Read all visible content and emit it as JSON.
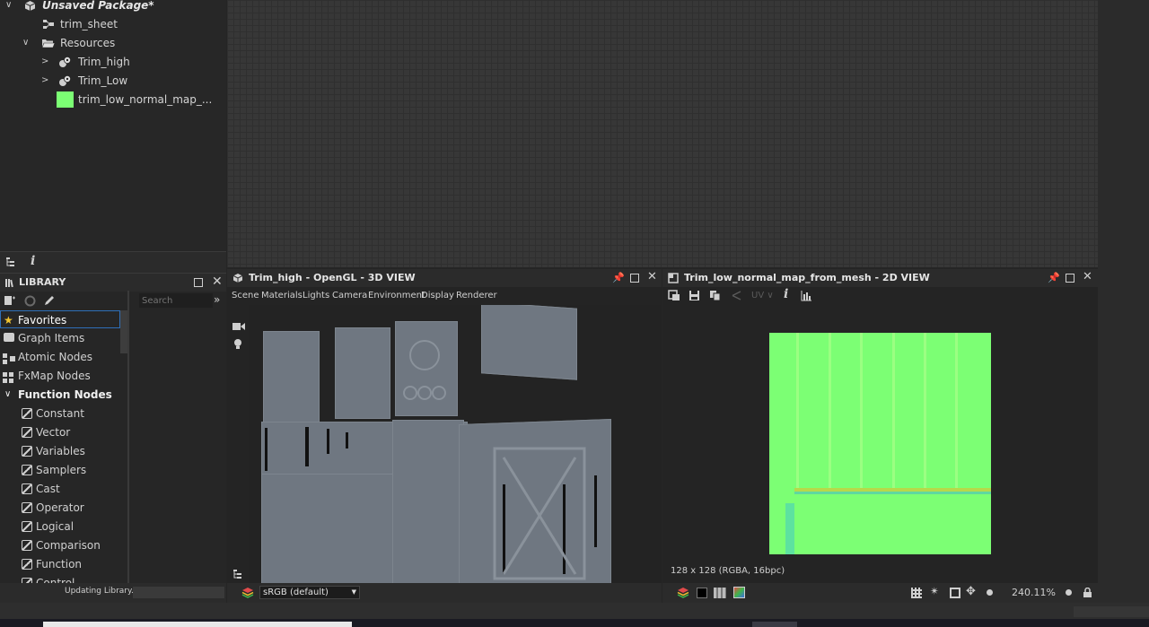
{
  "explorer": {
    "package_name": "Unsaved Package*",
    "items": [
      {
        "label": "trim_sheet"
      },
      {
        "label": "Resources"
      },
      {
        "label": "Trim_high"
      },
      {
        "label": "Trim_Low"
      },
      {
        "label": "trim_low_normal_map_..."
      }
    ]
  },
  "library": {
    "title": "LIBRARY",
    "search_placeholder": "Search",
    "items": [
      "Favorites",
      "Graph Items",
      "Atomic Nodes",
      "FxMap Nodes",
      "Function Nodes"
    ],
    "function_items": [
      "Constant",
      "Vector",
      "Variables",
      "Samplers",
      "Cast",
      "Operator",
      "Logical",
      "Comparison",
      "Function",
      "Control"
    ],
    "status": "Updating Library..."
  },
  "view3d": {
    "title": "Trim_high - OpenGL - 3D VIEW",
    "menu": [
      "Scene",
      "Materials",
      "Lights",
      "Camera",
      "Environment",
      "Display",
      "Renderer"
    ],
    "colorspace": "sRGB (default)"
  },
  "view2d": {
    "title": "Trim_low_normal_map_from_mesh - 2D VIEW",
    "uv_label": "UV",
    "info": "128 x 128 (RGBA, 16bpc)",
    "zoom": "240.11%"
  },
  "colors": {
    "normal_map": "#7cff74",
    "mesh_gray": "#6f7781",
    "graph_bg": "#373737",
    "accent_selection": "#2f6fb8"
  }
}
